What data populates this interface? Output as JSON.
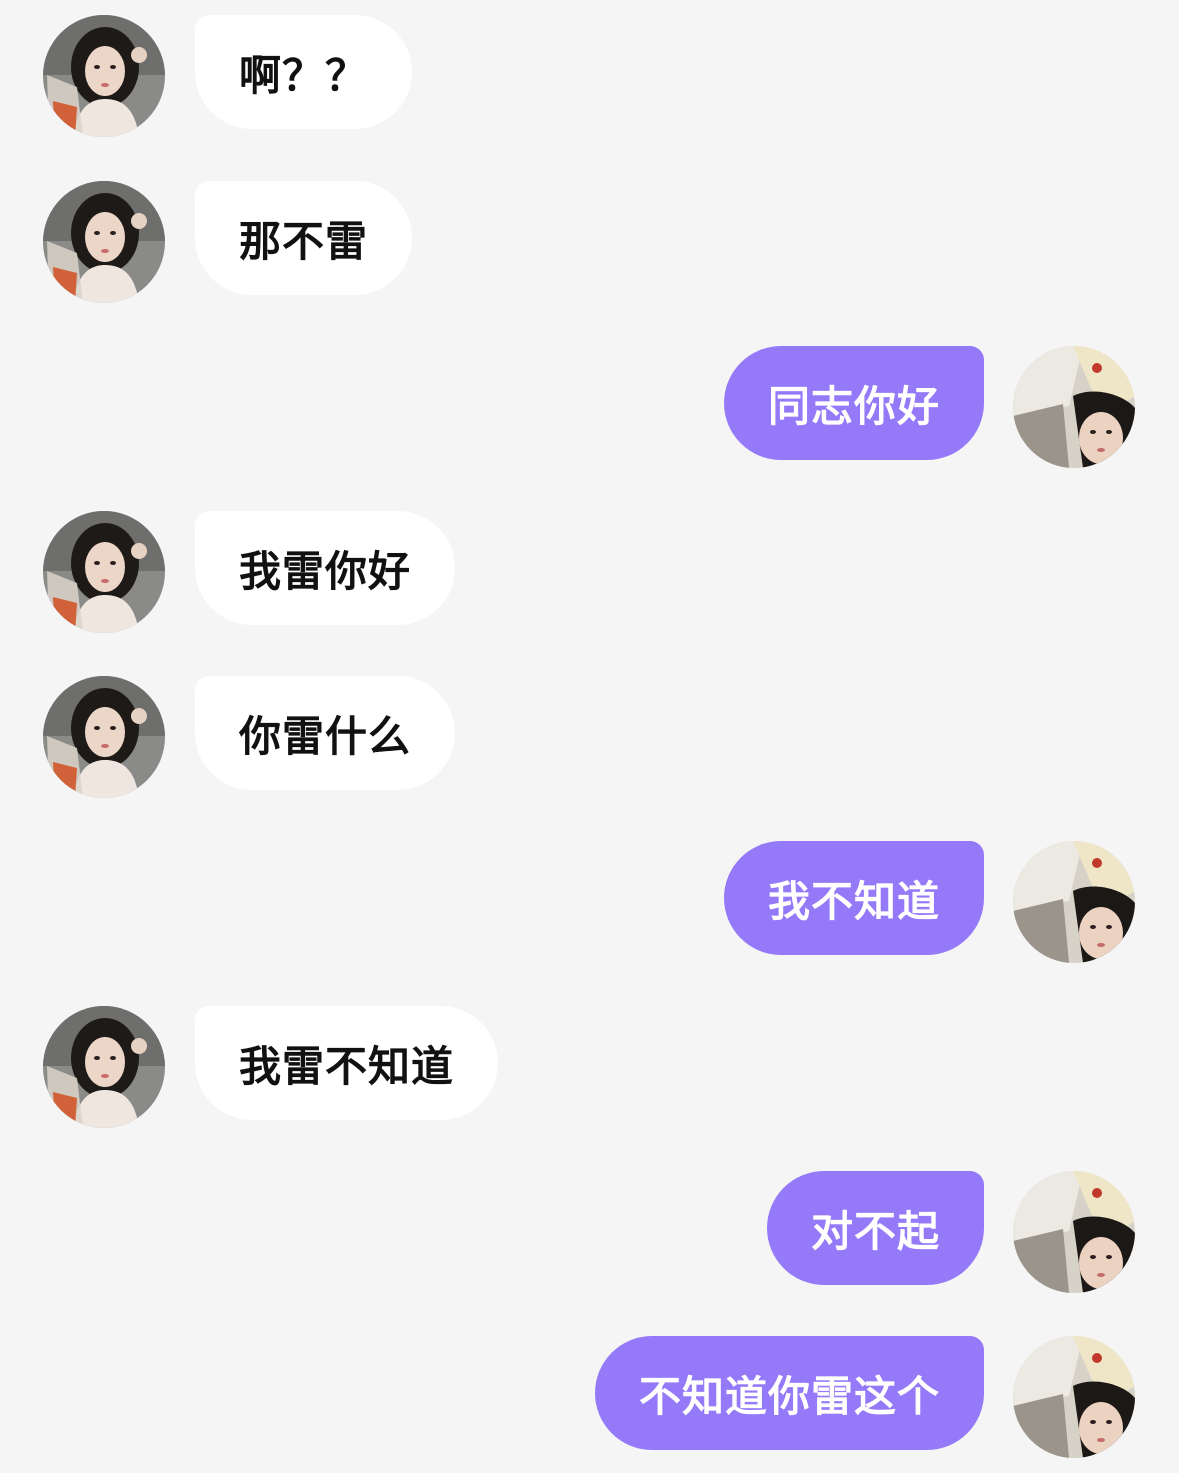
{
  "colors": {
    "background": "#f5f5f5",
    "incoming_bubble": "#ffffff",
    "outgoing_bubble": "#9479f8",
    "incoming_text": "#111111",
    "outgoing_text": "#ffffff"
  },
  "contact_avatar": "contact-avatar-photo",
  "user_avatar": "user-avatar-photo",
  "messages": [
    {
      "side": "incoming",
      "text": "啊？？"
    },
    {
      "side": "incoming",
      "text": "那不雷"
    },
    {
      "side": "outgoing",
      "text": "同志你好"
    },
    {
      "side": "incoming",
      "text": "我雷你好"
    },
    {
      "side": "incoming",
      "text": "你雷什么"
    },
    {
      "side": "outgoing",
      "text": "我不知道"
    },
    {
      "side": "incoming",
      "text": "我雷不知道"
    },
    {
      "side": "outgoing",
      "text": "对不起"
    },
    {
      "side": "outgoing",
      "text": "不知道你雷这个"
    }
  ]
}
